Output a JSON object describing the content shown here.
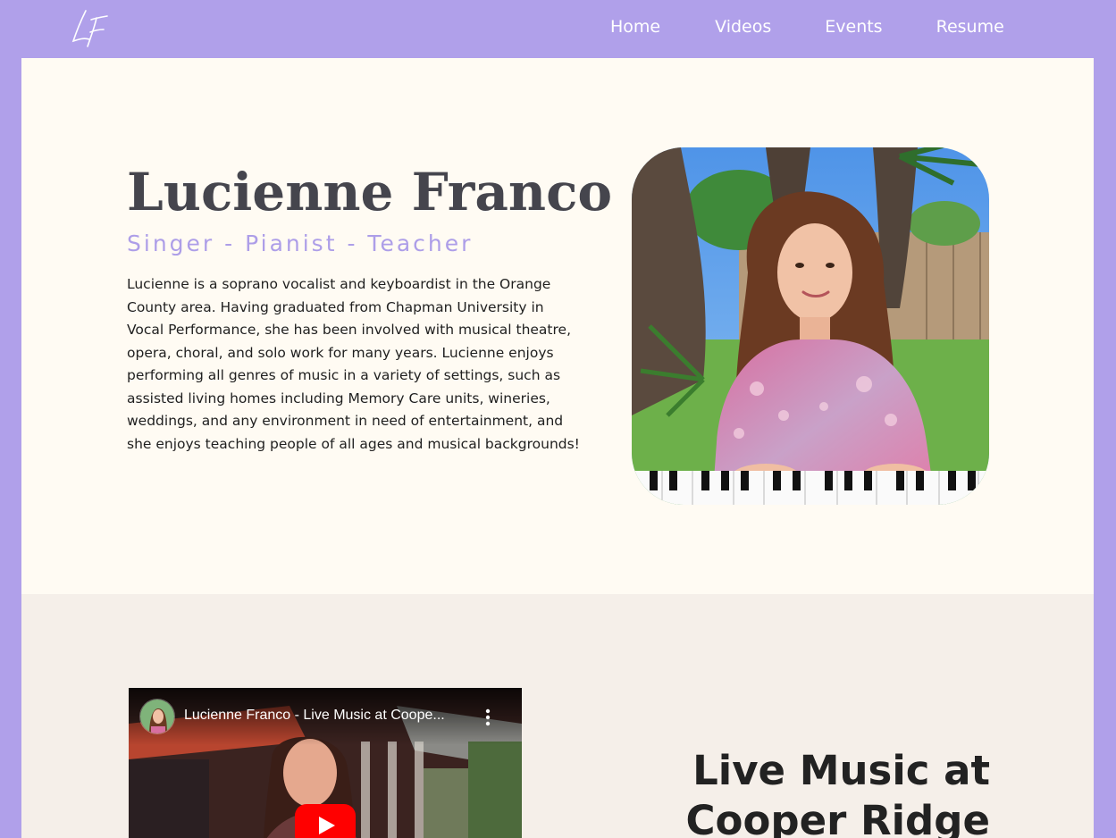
{
  "header": {
    "logo_text": "LF",
    "nav": [
      {
        "label": "Home"
      },
      {
        "label": "Videos"
      },
      {
        "label": "Events"
      },
      {
        "label": "Resume"
      }
    ]
  },
  "hero": {
    "name": "Lucienne Franco",
    "tagline": "Singer - Pianist - Teacher",
    "bio": "Lucienne is a soprano vocalist and keyboardist in the Orange County area. Having graduated from Chapman University in Vocal Performance, she has been involved with musical theatre, opera, choral, and solo work for many years. Lucienne enjoys performing all genres of music in a variety of settings, such as assisted living homes including Memory Care units, wineries, weddings, and any environment in need of entertainment, and she enjoys teaching people of all ages and musical backgrounds!"
  },
  "video_section": {
    "video_title": "Lucienne Franco - Live Music at Coope...",
    "heading_line1": "Live Music at",
    "heading_line2": "Cooper Ridge"
  },
  "colors": {
    "page_border": "#b0a0ea",
    "hero_bg": "#fffbf3",
    "video_bg": "#f5efe9",
    "accent": "#ad9ee8",
    "youtube_red": "#ff0000"
  },
  "icons": [
    "logo-monogram-icon",
    "play-icon",
    "more-vert-icon"
  ]
}
